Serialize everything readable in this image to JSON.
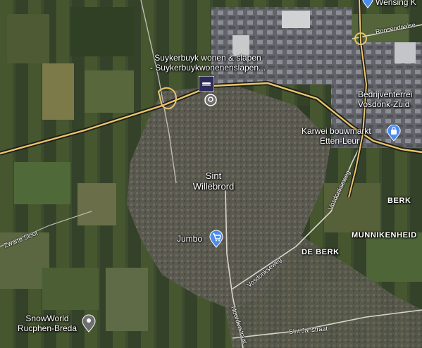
{
  "map": {
    "places": {
      "suykerbuyk_line1": "Suykerbuyk wonen & slapen",
      "suykerbuyk_line2": "- Suykerbuykwonenenslapen...",
      "wensing": "Wensing K",
      "bedrijventerrein_line1": "Bedrijventerrei",
      "bedrijventerrein_line2": "Vosdonk-Zuid",
      "karwei_line1": "Karwei bouwmarkt",
      "karwei_line2": "Etten-Leur",
      "sint_willebrord_line1": "Sint",
      "sint_willebrord_line2": "Willebrord",
      "jumbo": "Jumbo",
      "berk": "BERK",
      "munnikenheide": "MUNNIKENHEID",
      "de_berk": "DE BERK",
      "snowworld_line1": "SnowWorld",
      "snowworld_line2": "Rucphen-Breda"
    },
    "streets": {
      "roosendaalseweg": "Roosendaalse",
      "vosdonkseweg": "Vosdonkseweg",
      "zwarte_sloot": "Zwarte Sloot",
      "vosdonkseweg_lower": "Vosdonkseweg",
      "noordeinde": "Noorderstraat",
      "sint_janstraat": "Sint Janstraat"
    },
    "colors": {
      "highway": "#e8c66a",
      "shopping_pin": "#4b8cf0",
      "place_pin": "#6f6f6f",
      "hotel_logo": "#2c2b5a"
    },
    "icons": {
      "hotel": "hotel-logo-icon",
      "shopping": "shopping-bag-icon",
      "grocery": "shopping-cart-icon",
      "place": "location-pin-icon"
    }
  }
}
